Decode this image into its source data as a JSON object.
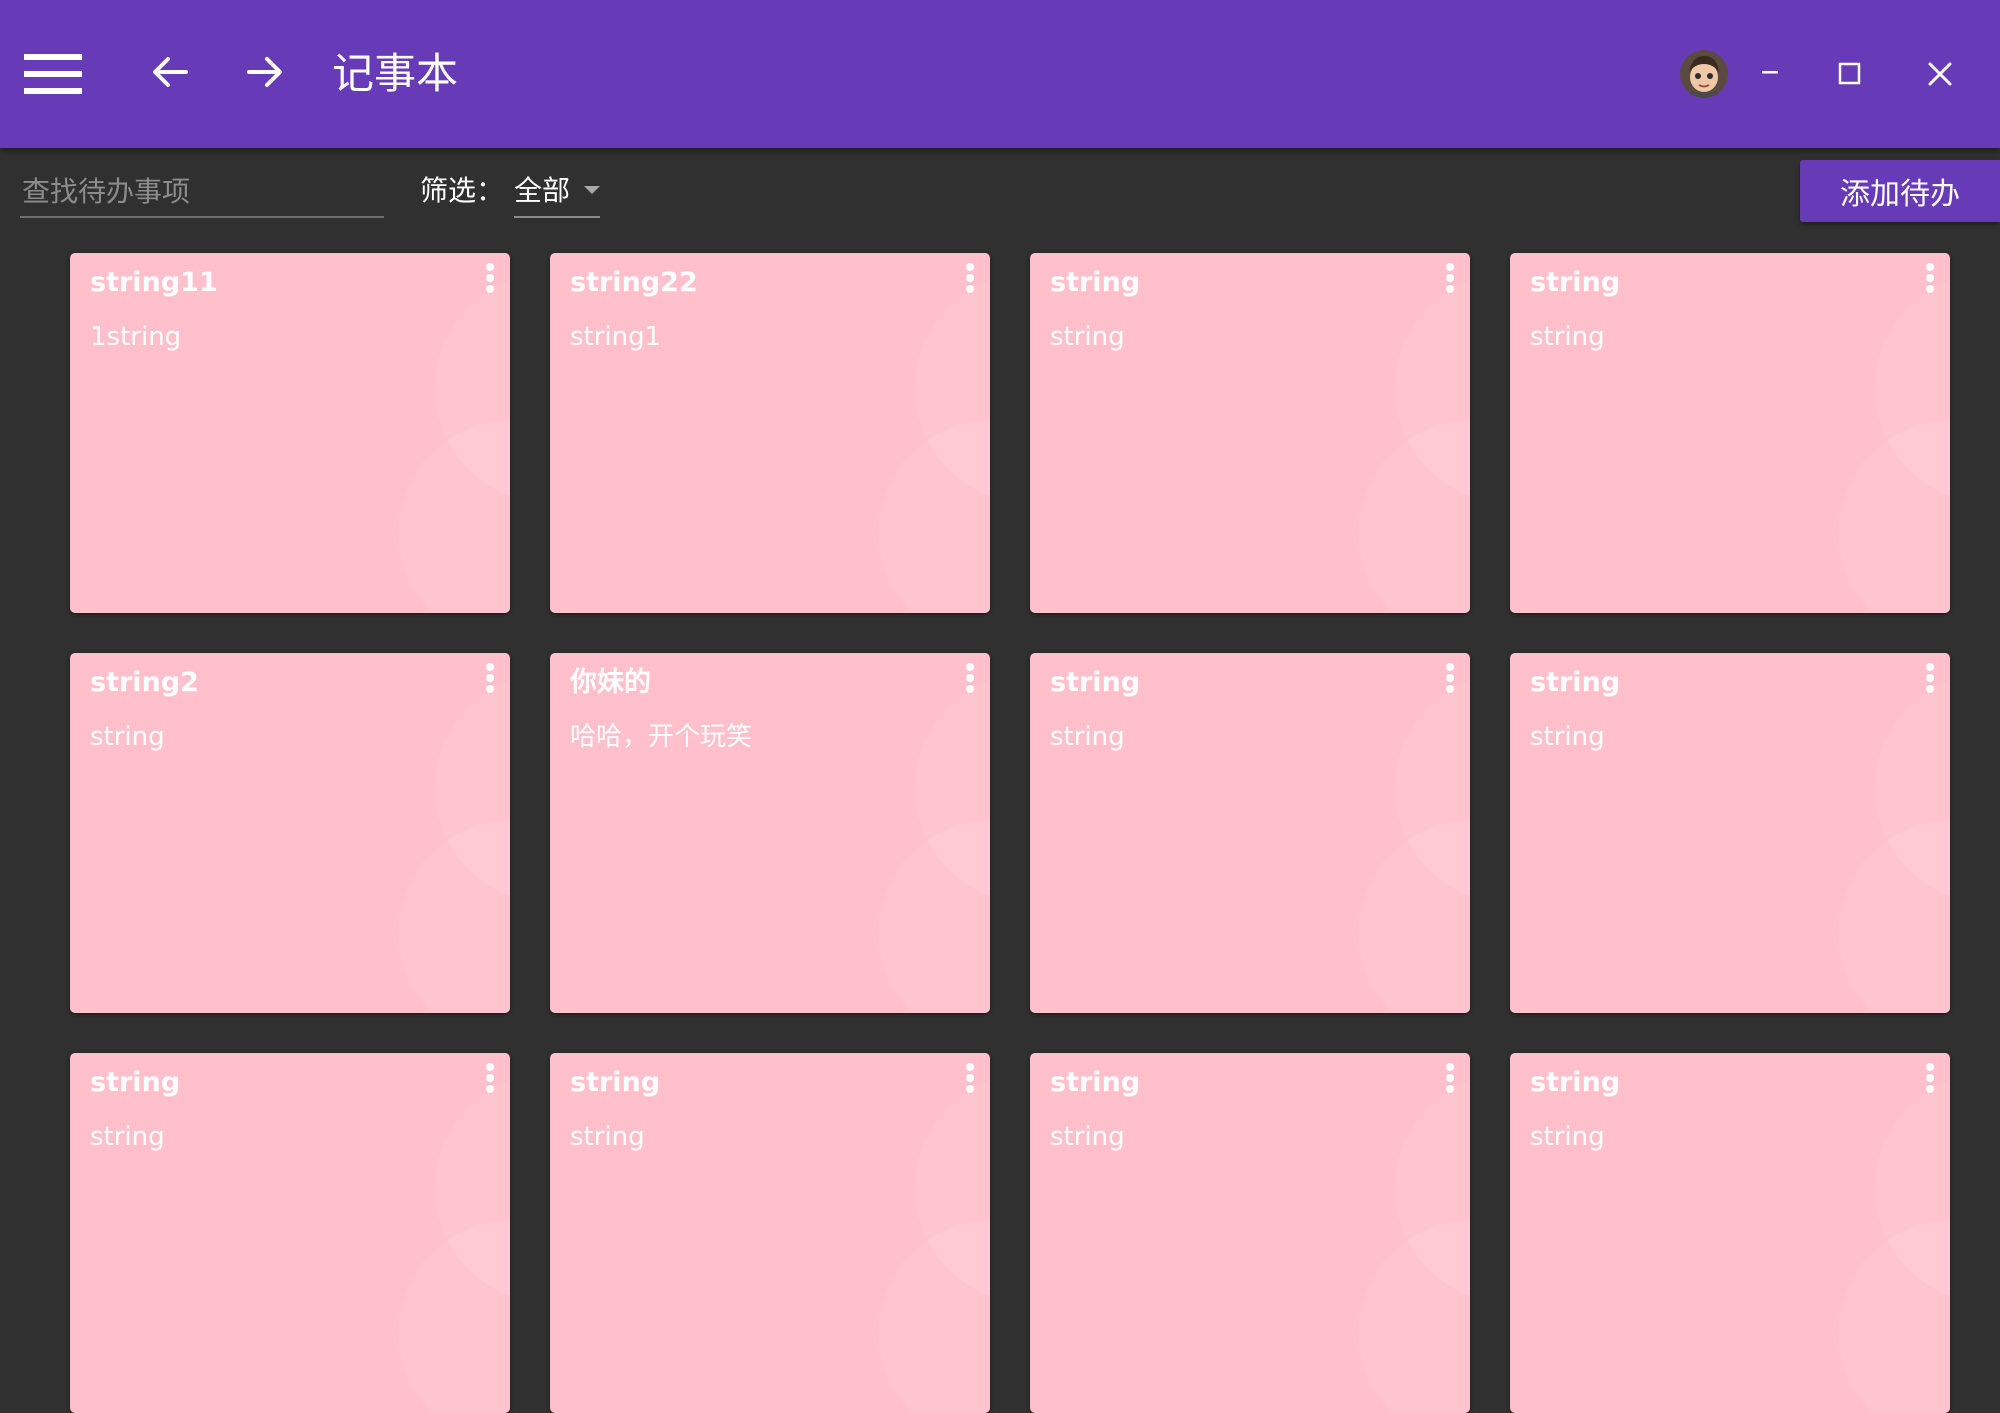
{
  "window": {
    "title": "记事本",
    "controls": {
      "menu_icon": "hamburger-menu-icon",
      "back_icon": "arrow-left-icon",
      "forward_icon": "arrow-right-icon",
      "minimize_icon": "minimize-icon",
      "maximize_icon": "maximize-icon",
      "close_icon": "close-icon"
    }
  },
  "toolbar": {
    "search_placeholder": "查找待办事项",
    "search_value": "",
    "filter_label": "筛选：",
    "filter_value": "全部",
    "add_label": "添加待办"
  },
  "colors": {
    "accent": "#673ab7",
    "background": "#303030",
    "card": "#ffc0cb"
  },
  "todos": [
    {
      "title": "string11",
      "content": "1string"
    },
    {
      "title": "string22",
      "content": "string1"
    },
    {
      "title": "string",
      "content": "string"
    },
    {
      "title": "string",
      "content": "string"
    },
    {
      "title": "string2",
      "content": "string"
    },
    {
      "title": "你妹的",
      "content": "哈哈，开个玩笑"
    },
    {
      "title": "string",
      "content": "string"
    },
    {
      "title": "string",
      "content": "string"
    },
    {
      "title": "string",
      "content": "string"
    },
    {
      "title": "string",
      "content": "string"
    },
    {
      "title": "string",
      "content": "string"
    },
    {
      "title": "string",
      "content": "string"
    }
  ]
}
